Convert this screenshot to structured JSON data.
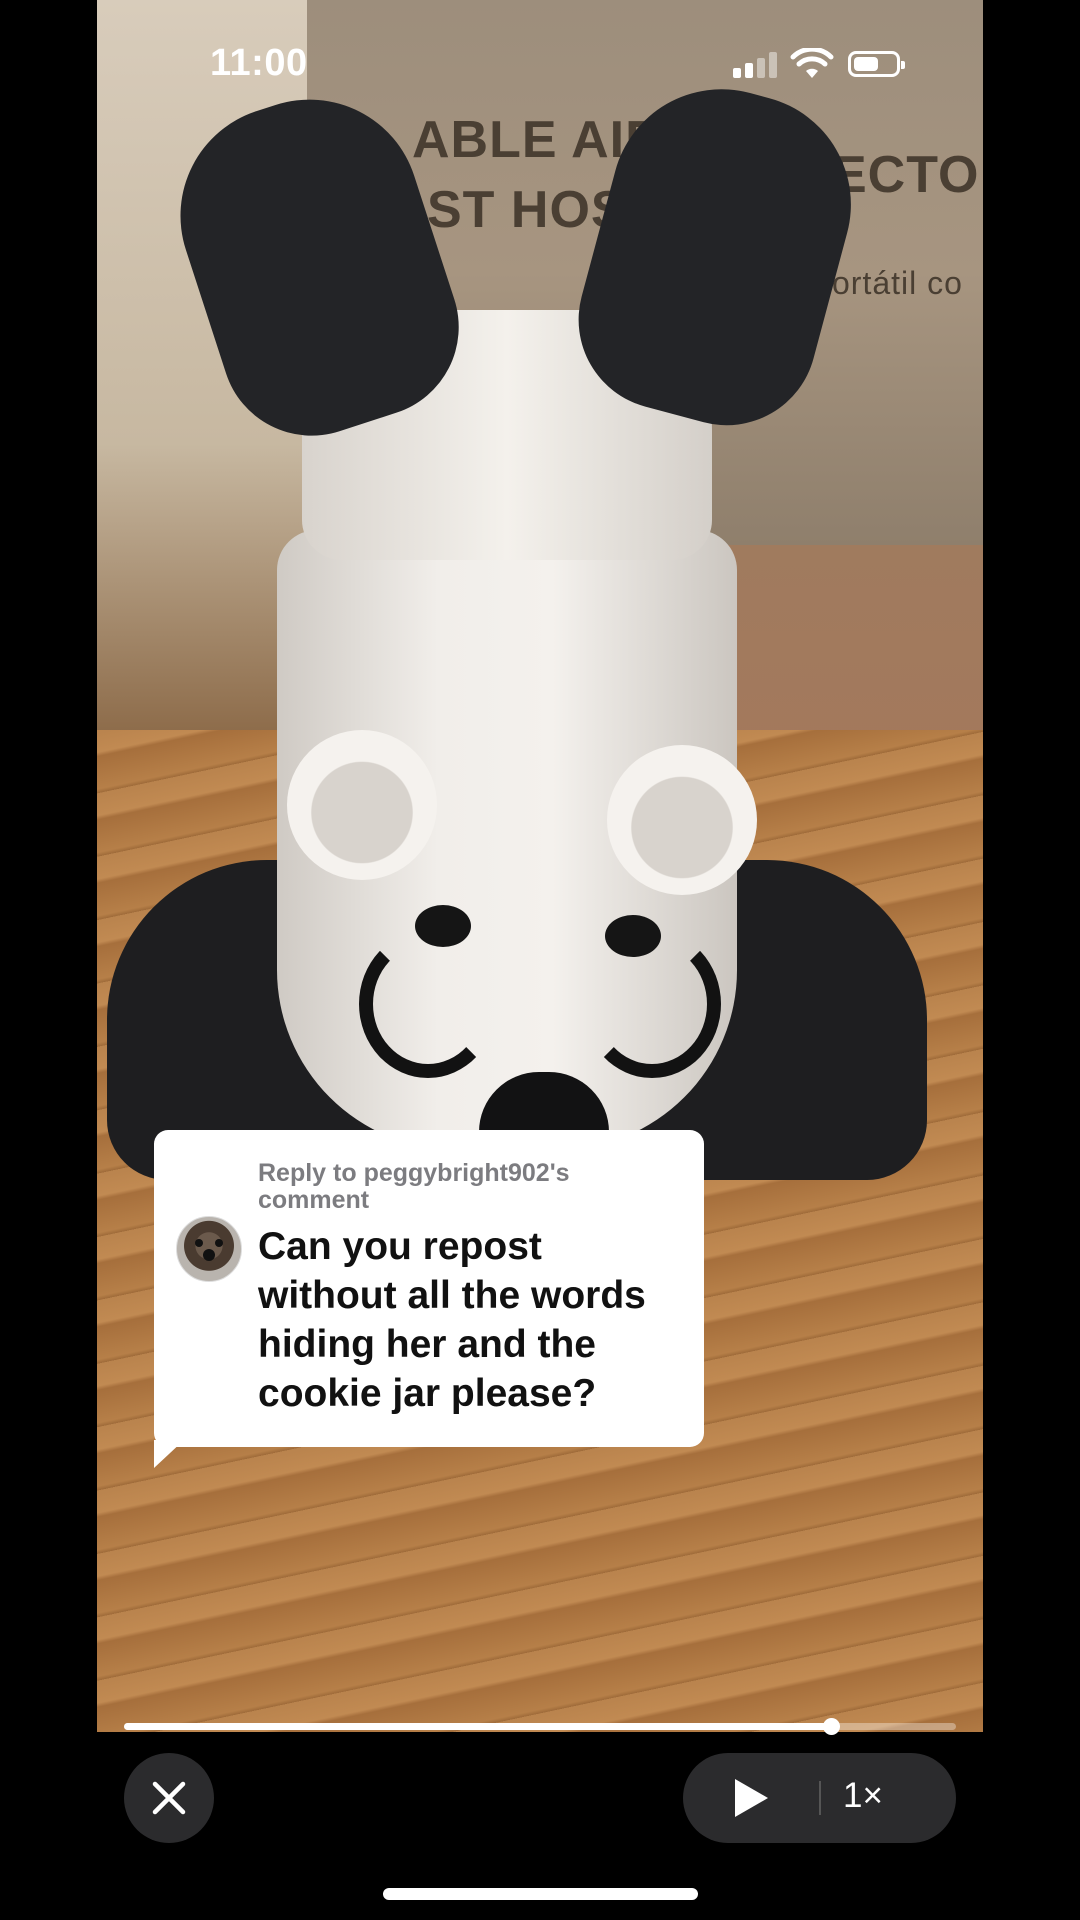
{
  "status_bar": {
    "time": "11:00",
    "icons": [
      "cellular-signal-icon",
      "wifi-icon",
      "battery-icon"
    ]
  },
  "video": {
    "background_text": {
      "line1": "ABLE AIR CO",
      "line2": "ST HOSE",
      "line3": "ECTO",
      "line4": "ortátil co"
    }
  },
  "reply_bubble": {
    "reply_label": "Reply to peggybright902's comment",
    "comment_text": "Can you repost without all the words hiding her and the cookie jar please?"
  },
  "playback": {
    "progress_fraction": 0.85
  },
  "controls": {
    "speed_label": "1×",
    "icons": [
      "close-icon",
      "play-icon"
    ]
  },
  "colors": {
    "background": "#000000",
    "control_bg": "#2b2b2d",
    "bubble_bg": "#ffffff"
  }
}
